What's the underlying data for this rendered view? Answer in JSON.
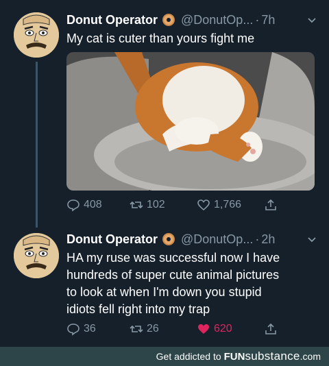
{
  "tweets": [
    {
      "author_name": "Donut Operator",
      "handle": "@DonutOp...",
      "separator": "·",
      "time": "7h",
      "text": "My cat is cuter than yours fight me",
      "replies": "408",
      "retweets": "102",
      "likes": "1,766",
      "liked": false
    },
    {
      "author_name": "Donut Operator",
      "handle": "@DonutOp...",
      "separator": "·",
      "time": "2h",
      "text": "HA my ruse was successful now I have\nhundreds of super cute animal pictures\nto look at when I'm down you stupid\nidiots fell right into my trap",
      "replies": "36",
      "retweets": "26",
      "likes": "620",
      "liked": true
    }
  ],
  "footer": {
    "prefix": "Get addicted to",
    "brand_fun": "FUN",
    "brand_sub": "substance",
    "brand_tld": ".com"
  },
  "colors": {
    "background": "#15202b",
    "muted": "#8899a6",
    "like_active": "#e0245e",
    "footer_bg": "#2d4548"
  }
}
